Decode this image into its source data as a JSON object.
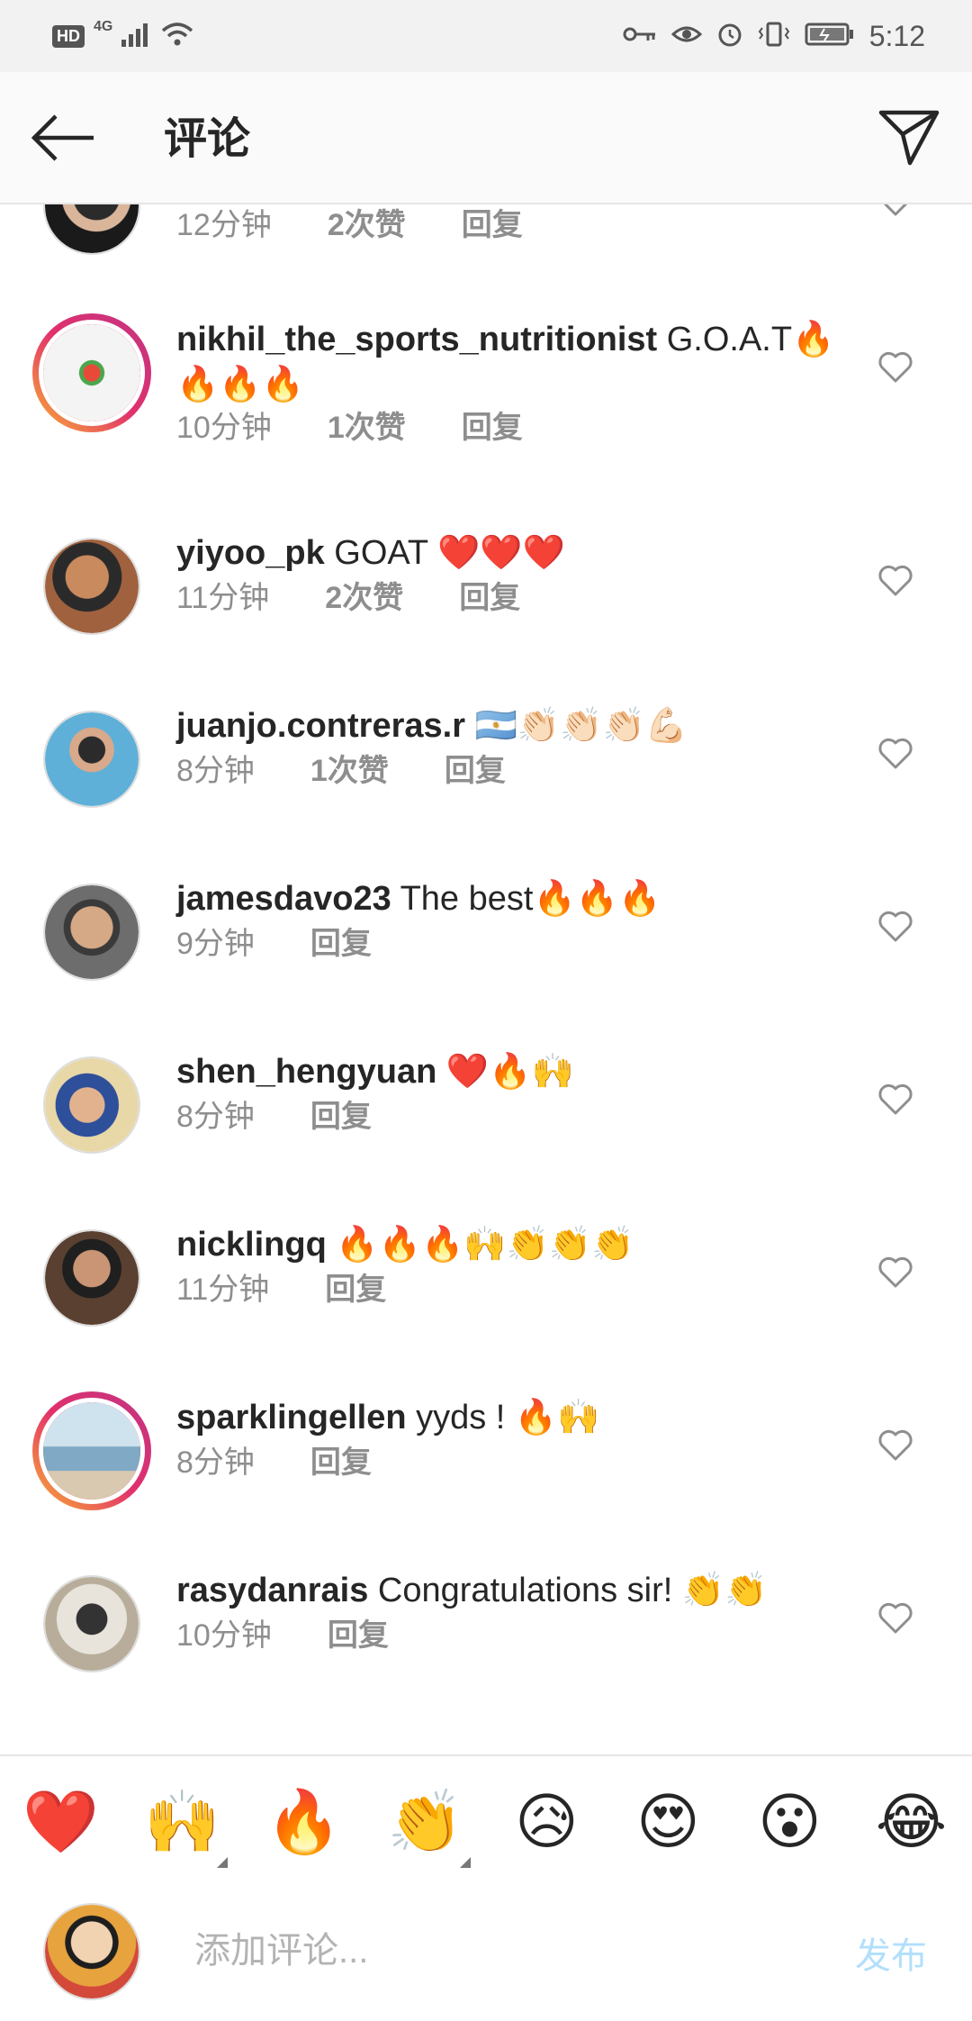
{
  "status_bar": {
    "hd": "HD",
    "network": "4G",
    "time": "5:12"
  },
  "header": {
    "title": "评论",
    "back_icon": "arrow-left-icon",
    "share_icon": "paper-plane-icon"
  },
  "partial_comment": {
    "time": "12分钟",
    "likes": "2次赞",
    "reply": "回复"
  },
  "comments": [
    {
      "username": "nikhil_the_sports_nutritionist",
      "text": " G.O.A.T🔥🔥🔥🔥",
      "time": "10分钟",
      "likes": "1次赞",
      "reply": "回复",
      "story_ring": true,
      "avatar_color": "#f4f4f4"
    },
    {
      "username": "yiyoo_pk",
      "text": " GOAT ❤️❤️❤️",
      "time": "11分钟",
      "likes": "2次赞",
      "reply": "回复",
      "story_ring": false,
      "avatar_color": "#a0623e"
    },
    {
      "username": "juanjo.contreras.r",
      "text": " 🇦🇷👏🏻👏🏻👏🏻💪🏻",
      "time": "8分钟",
      "likes": "1次赞",
      "reply": "回复",
      "story_ring": false,
      "avatar_color": "#3a7ea8"
    },
    {
      "username": "jamesdavo23",
      "text": " The best🔥🔥🔥",
      "time": "9分钟",
      "likes": "",
      "reply": "回复",
      "story_ring": false,
      "avatar_color": "#6d6d6d"
    },
    {
      "username": "shen_hengyuan",
      "text": " ❤️🔥🙌",
      "time": "8分钟",
      "likes": "",
      "reply": "回复",
      "story_ring": false,
      "avatar_color": "#2e4f9a"
    },
    {
      "username": "nicklingq",
      "text": " 🔥🔥🔥🙌👏👏👏",
      "time": "11分钟",
      "likes": "",
      "reply": "回复",
      "story_ring": false,
      "avatar_color": "#5a4030"
    },
    {
      "username": "sparklingellen",
      "text": " yyds !  🔥🙌",
      "time": "8分钟",
      "likes": "",
      "reply": "回复",
      "story_ring": true,
      "avatar_color": "#9ec4d8"
    },
    {
      "username": "rasydanrais",
      "text": " Congratulations sir! 👏👏",
      "time": "10分钟",
      "likes": "",
      "reply": "回复",
      "story_ring": false,
      "avatar_color": "#b8ad9a"
    }
  ],
  "reactions": [
    "❤️",
    "🙌",
    "🔥",
    "👏",
    "😥",
    "😍",
    "😮",
    "😂"
  ],
  "composer": {
    "placeholder": "添加评论...",
    "post_label": "发布"
  },
  "colors": {
    "text": "#262626",
    "meta": "#8e8e8e",
    "post_disabled": "#b2dffc",
    "heart": "#8e8e8e"
  }
}
